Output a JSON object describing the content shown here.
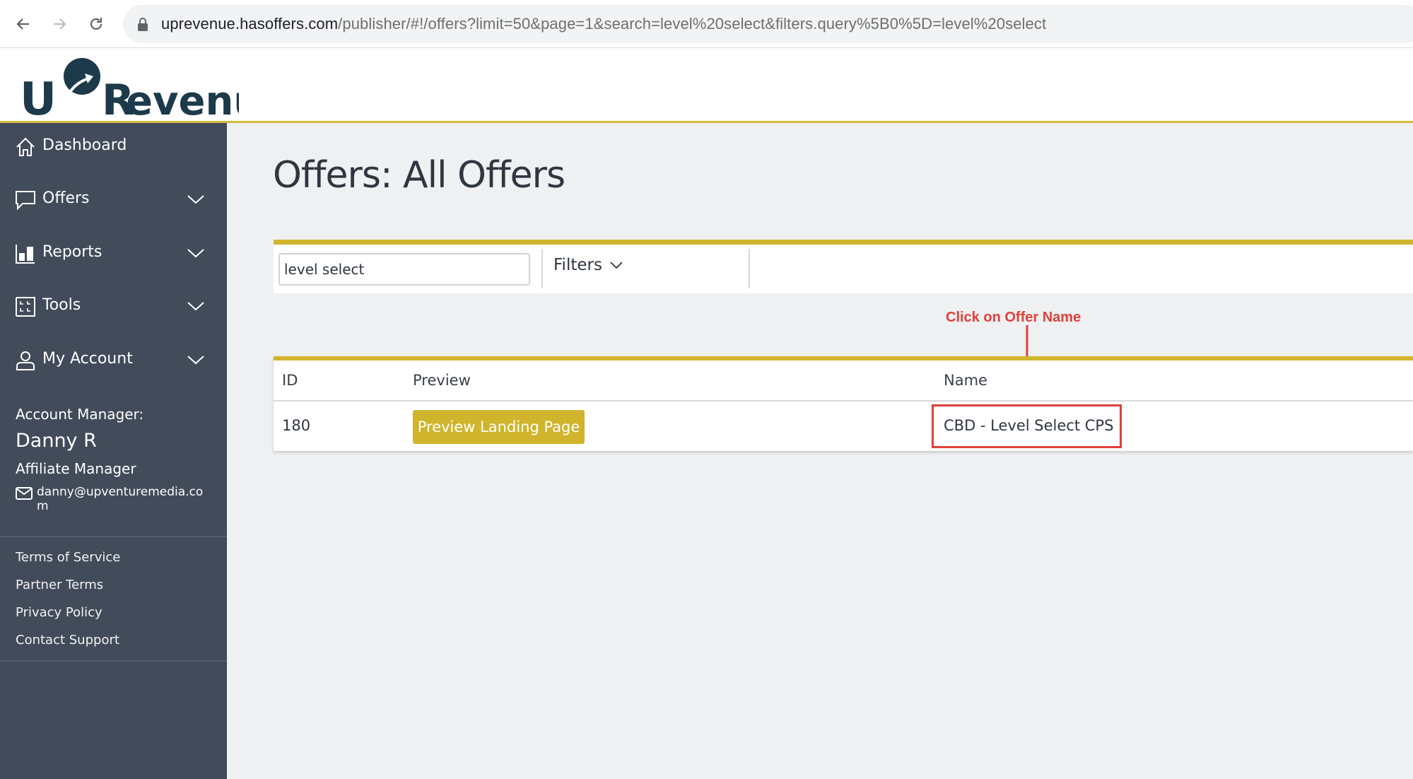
{
  "browser": {
    "url_host": "uprevenue.hasoffers.com",
    "url_path": "/publisher/#!/offers?limit=50&page=1&search=level%20select&filters.query%5B0%5D=level%20select",
    "icons": [
      "back-arrow-icon",
      "forward-arrow-icon",
      "reload-icon",
      "lock-icon"
    ]
  },
  "brand": {
    "logo_text": "UpRevenue",
    "logo_color": "#1c3a4a",
    "accent_color": "#d0b52c"
  },
  "sidebar": {
    "items": [
      {
        "label": "Dashboard",
        "icon": "home-icon",
        "has_chevron": false
      },
      {
        "label": "Offers",
        "icon": "chat-bubble-icon",
        "has_chevron": true
      },
      {
        "label": "Reports",
        "icon": "bar-chart-icon",
        "has_chevron": true
      },
      {
        "label": "Tools",
        "icon": "tools-grid-icon",
        "has_chevron": true
      },
      {
        "label": "My Account",
        "icon": "user-icon",
        "has_chevron": true
      }
    ],
    "account_manager": {
      "label": "Account Manager:",
      "name": "Danny R",
      "role": "Affiliate Manager",
      "email": "danny@upventuremedia.com"
    },
    "footer_links": [
      "Terms of Service",
      "Partner Terms",
      "Privacy Policy",
      "Contact Support"
    ]
  },
  "main": {
    "title": "Offers: All Offers",
    "search": {
      "value": "level select",
      "placeholder": ""
    },
    "filters_label": "Filters",
    "annotation": "Click on Offer Name",
    "annotation_color": "#e0403a",
    "table": {
      "columns": [
        "ID",
        "Preview",
        "Name"
      ],
      "rows": [
        {
          "id": "180",
          "preview_label": "Preview Landing Page",
          "name": "CBD - Level Select CPS"
        }
      ]
    }
  }
}
